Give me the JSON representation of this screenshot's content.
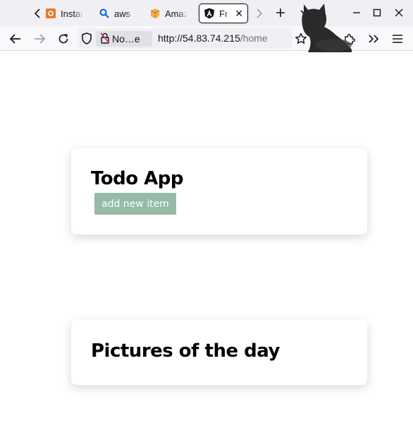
{
  "browser": {
    "tabs": [
      {
        "label": "Instar",
        "favicon": "instance-icon"
      },
      {
        "label": "aws e",
        "favicon": "search-icon"
      },
      {
        "label": "Amaz",
        "favicon": "package-icon"
      },
      {
        "label": "Fro",
        "favicon": "angular-icon",
        "active": true
      }
    ],
    "identity_label": "No…e",
    "url_host": "http://54.83.74.215",
    "url_path": "/home"
  },
  "page": {
    "todo": {
      "title": "Todo App",
      "add_button_label": "add new item"
    },
    "pictures": {
      "title": "Pictures of the day"
    }
  },
  "colors": {
    "add_button_bg": "#95bba8",
    "tabstrip_bg": "#f0f0f4",
    "page_bg": "#ffffff"
  }
}
